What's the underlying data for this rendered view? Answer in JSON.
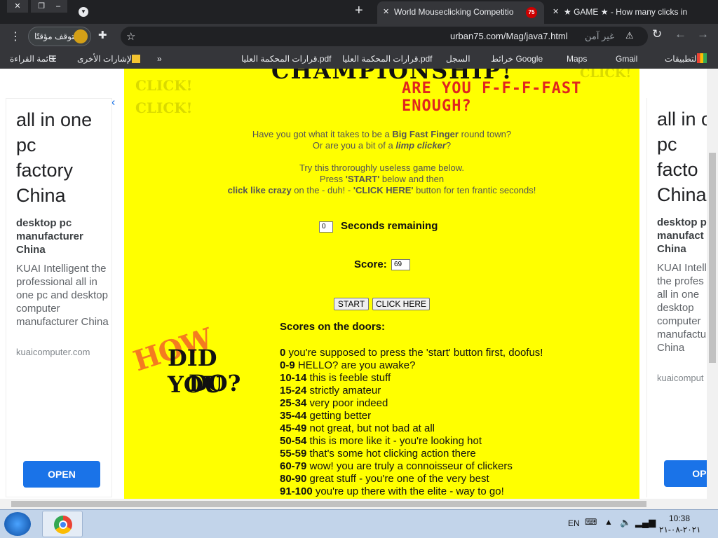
{
  "browser": {
    "tabs": [
      {
        "title": "World Mouseclicking Competitio",
        "badge": "75",
        "active": true
      },
      {
        "title": "★ GAME ★ - How many clicks in",
        "active": false
      }
    ],
    "url": "urban75.com/Mag/java7.html",
    "security_label": "غير آمن",
    "profile_label": "متوقف مؤقتًا",
    "new_tab": "+",
    "close_tab": "✕"
  },
  "bookmarks": {
    "apps": "التطبيقات",
    "items": [
      "Gmail",
      "Maps",
      "خرائط Google",
      "السجل",
      "قرارات المحكمة العليا.pdf",
      "قرارات المحكمة العليا.pdf"
    ],
    "more": "»",
    "other": "الإشارات الأخرى",
    "reading_list": "قائمة القراءة"
  },
  "ads": {
    "headline": [
      "all in one",
      "pc",
      "factory",
      "China"
    ],
    "right_headline": [
      "all in o",
      "pc",
      "facto",
      "China"
    ],
    "sub": "desktop pc manufacturer China",
    "right_sub": "desktop pc manufact China",
    "body": "KUAI Intelligent the professional all in one pc and desktop computer manufacturer China",
    "right_body": "KUAI Intell the profes all in one desktop computer manufactu China",
    "domain": "kuaicomputer.com",
    "right_domain": "kuaicomput",
    "open": "OPEN",
    "right_open": "OPE"
  },
  "game": {
    "heading": "CHAMPIONSHIP!",
    "tagline": "ARE YOU F-F-F-FAST ENOUGH?",
    "click_words": [
      "CLICK!",
      "CLICK!"
    ],
    "ghost_click": "CLICK!",
    "intro1a": "Have you got what it takes to be a ",
    "intro1b": "Big Fast Finger",
    "intro1c": " round town?",
    "intro2a": "Or are you a bit of a ",
    "intro2b": "limp clicker",
    "intro2c": "?",
    "intro3": "Try this throroughly useless game below.",
    "intro4a": "Press ",
    "intro4b": "'START'",
    "intro4c": " below and then",
    "intro5a": "click like crazy",
    "intro5b": " on the - duh! - ",
    "intro5c": "'CLICK HERE'",
    "intro5d": " button for ten frantic seconds!",
    "seconds_value": "0",
    "seconds_label": "Seconds remaining",
    "score_label": "Score:",
    "score_value": "69",
    "start_button": "START",
    "click_button": "CLICK HERE",
    "doors_title": "Scores on the doors:",
    "how_word": "HOW",
    "did_you": "DID YOU",
    "do_word": "DO?",
    "scores": [
      {
        "range": "0",
        "text": "you're supposed to press the 'start' button first, doofus!"
      },
      {
        "range": "0-9",
        "text": "HELLO? are you awake?"
      },
      {
        "range": "10-14",
        "text": "this is feeble stuff"
      },
      {
        "range": "15-24",
        "text": "strictly amateur"
      },
      {
        "range": "25-34",
        "text": "very poor indeed"
      },
      {
        "range": "35-44",
        "text": "getting better"
      },
      {
        "range": "45-49",
        "text": "not great, but not bad at all"
      },
      {
        "range": "50-54",
        "text": "this is more like it - you're looking hot"
      },
      {
        "range": "55-59",
        "text": "that's some hot clicking action there"
      },
      {
        "range": "60-79",
        "text": "wow! you are truly a connoisseur of clickers"
      },
      {
        "range": "80-90",
        "text": "great stuff - you're one of the very best"
      },
      {
        "range": "91-100",
        "text": "you're up there with the elite - way to go!"
      }
    ]
  },
  "taskbar": {
    "lang": "EN",
    "time": "10:38",
    "date": "٢٠٢١-٠٨-٢١"
  }
}
